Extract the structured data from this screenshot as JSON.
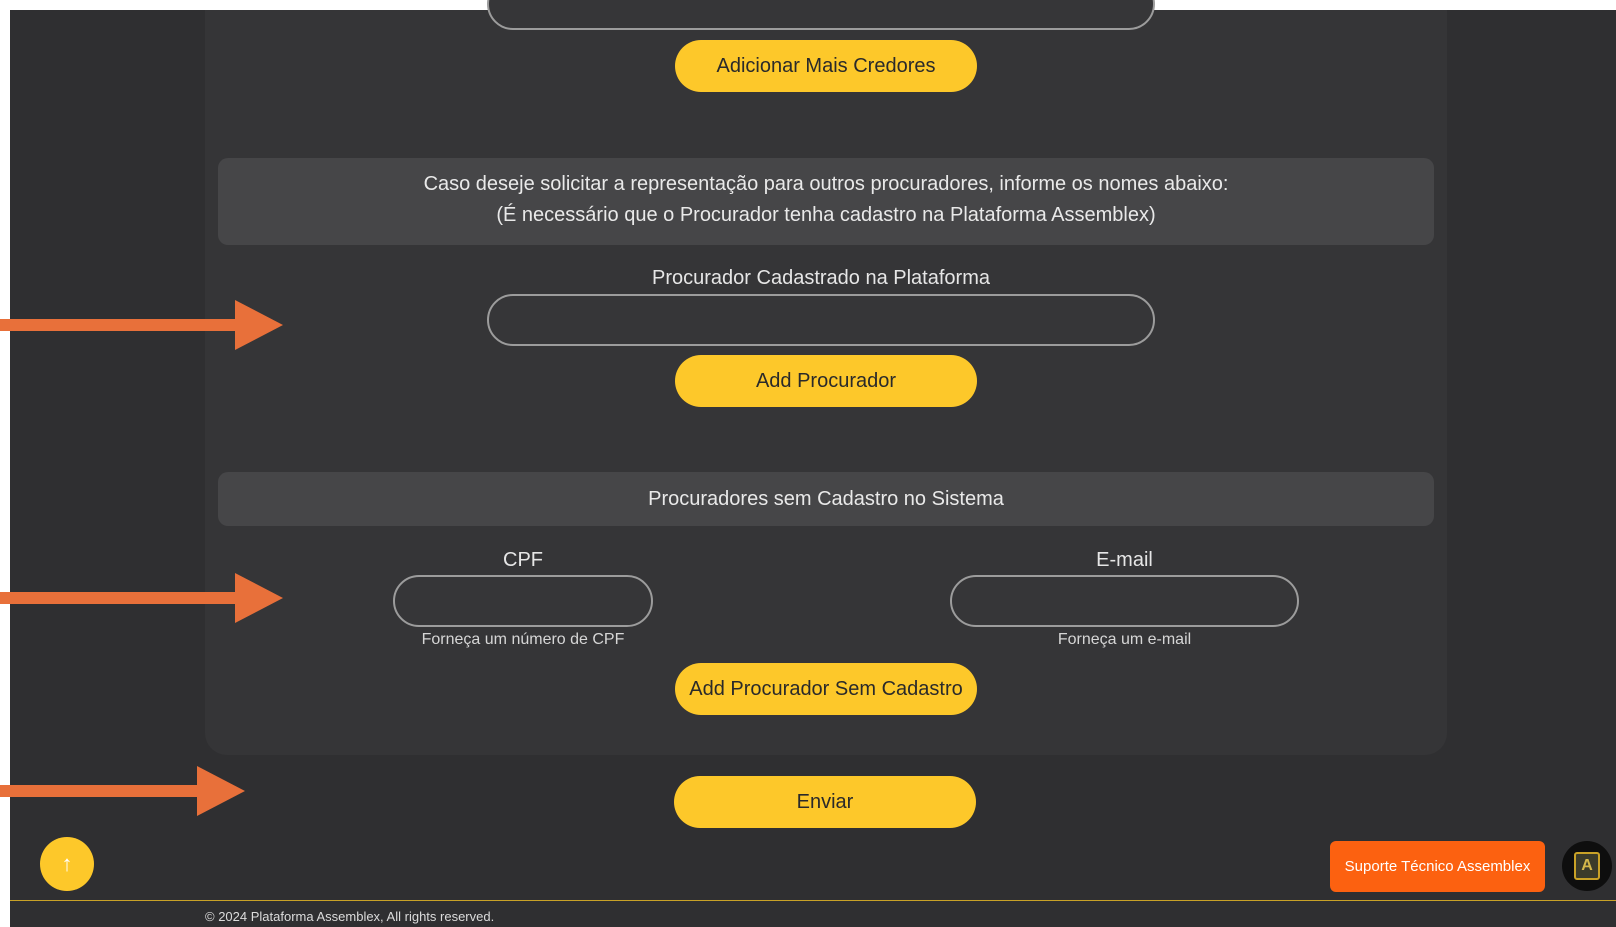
{
  "buttons": {
    "add_creditors": "Adicionar Mais Credores",
    "add_attorney": "Add Procurador",
    "add_unregistered": "Add Procurador Sem Cadastro",
    "submit": "Enviar"
  },
  "info": {
    "line1": "Caso deseje solicitar a representação para outros procuradores, informe os nomes abaixo:",
    "line2": "(É necessário que o Procurador tenha cadastro na Plataforma Assemblex)"
  },
  "registered": {
    "label": "Procurador Cadastrado na Plataforma",
    "value": ""
  },
  "unregistered": {
    "title": "Procuradores sem Cadastro no Sistema",
    "cpf_label": "CPF",
    "cpf_help": "Forneça um número de CPF",
    "cpf_value": "",
    "email_label": "E-mail",
    "email_help": "Forneça um e-mail",
    "email_value": ""
  },
  "scroll_top_icon": "↑",
  "support": {
    "label": "Suporte Técnico Assemblex",
    "logo_letter": "A"
  },
  "footer": {
    "copyright": "© 2024 Plataforma Assemblex, All rights reserved."
  },
  "colors": {
    "background": "#2f2f31",
    "card": "#353537",
    "accent_yellow": "#fdc82a",
    "arrow_orange": "#e8703a",
    "support_orange": "#fc6110"
  }
}
